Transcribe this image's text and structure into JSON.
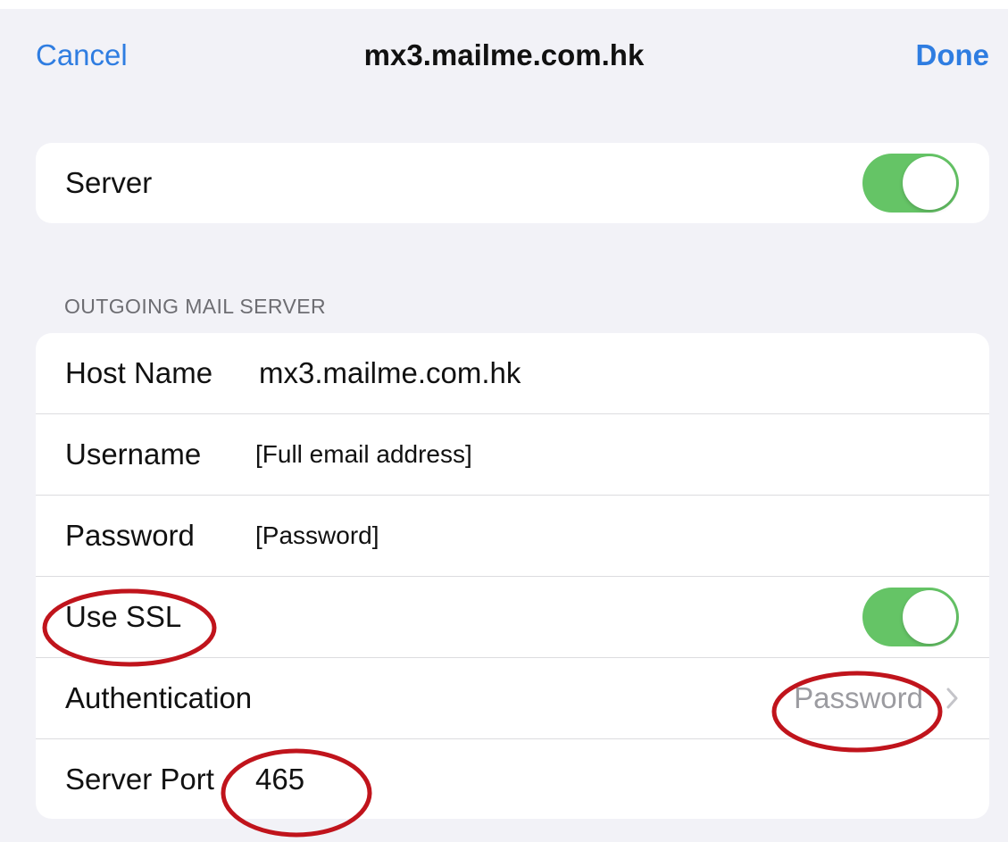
{
  "nav": {
    "cancel_label": "Cancel",
    "title": "mx3.mailme.com.hk",
    "done_label": "Done"
  },
  "server_group": {
    "label": "Server",
    "toggle_on": true
  },
  "outgoing": {
    "section_header": "OUTGOING MAIL SERVER",
    "host_name_label": "Host Name",
    "host_name_value": "mx3.mailme.com.hk",
    "username_label": "Username",
    "username_value": "[Full email address]",
    "password_label": "Password",
    "password_value": "[Password]",
    "use_ssl_label": "Use SSL",
    "use_ssl_on": true,
    "authentication_label": "Authentication",
    "authentication_value": "Password",
    "server_port_label": "Server Port",
    "server_port_value": "465"
  },
  "colors": {
    "accent_blue": "#2f7de1",
    "toggle_green": "#65c466",
    "annotation_red": "#c0141c",
    "background": "#f2f2f7",
    "secondary_text": "#9b9ba0"
  },
  "icons": {
    "authentication_disclosure": "chevron-right-icon"
  }
}
